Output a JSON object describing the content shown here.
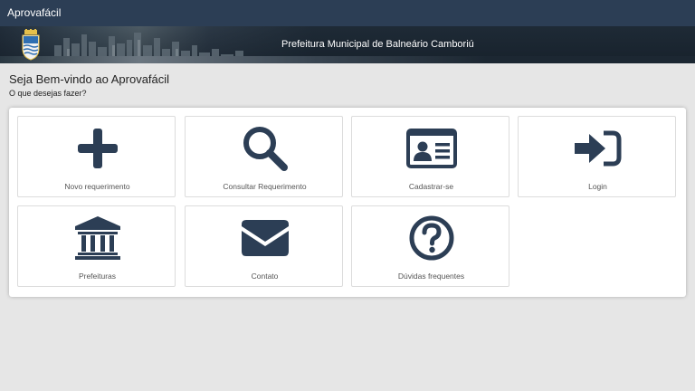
{
  "app": {
    "title": "Aprovafácil"
  },
  "banner": {
    "title": "Prefeitura Municipal de Balneário Camboriú",
    "crest_icon": "municipal-crest-icon"
  },
  "main": {
    "heading": "Seja Bem-vindo ao Aprovafácil",
    "subheading": "O que desejas fazer?"
  },
  "tiles": [
    {
      "label": "Novo requerimento",
      "icon": "plus-icon"
    },
    {
      "label": "Consultar Requerimento",
      "icon": "search-icon"
    },
    {
      "label": "Cadastrar-se",
      "icon": "id-card-icon"
    },
    {
      "label": "Login",
      "icon": "sign-in-icon"
    },
    {
      "label": "Prefeituras",
      "icon": "bank-icon"
    },
    {
      "label": "Contato",
      "icon": "envelope-icon"
    },
    {
      "label": "Dúvidas frequentes",
      "icon": "question-circle-icon"
    }
  ],
  "colors": {
    "topbar": "#2c3e55",
    "icon": "#2c3e55",
    "background": "#e6e6e6"
  }
}
